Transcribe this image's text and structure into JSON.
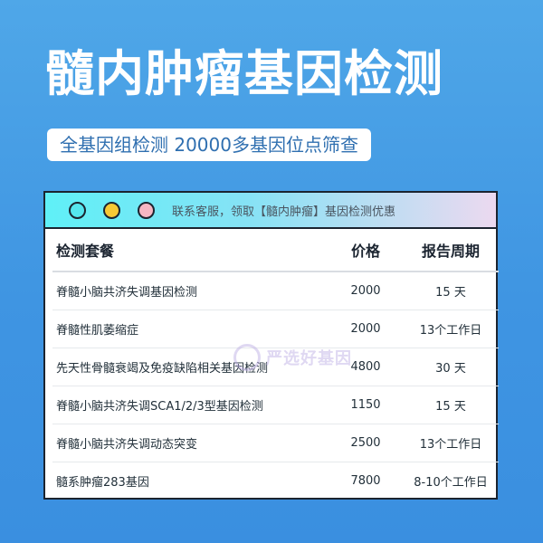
{
  "header": {
    "title": "髓内肿瘤基因检测",
    "subtitle": "全基因组检测 20000多基因位点筛查"
  },
  "window": {
    "notice": "联系客服，领取【髓内肿瘤】基因检测优惠",
    "dots": [
      "#55e6ee",
      "#f7c934",
      "#f5b6c3"
    ]
  },
  "table": {
    "headers": [
      "检测套餐",
      "价格",
      "报告周期"
    ],
    "rows": [
      {
        "name": "脊髓小脑共济失调基因检测",
        "price": "2000",
        "period": "15 天"
      },
      {
        "name": "脊髓性肌萎缩症",
        "price": "2000",
        "period": "13个工作日"
      },
      {
        "name": "先天性骨髓衰竭及免疫缺陷相关基因检测",
        "price": "4800",
        "period": "30 天"
      },
      {
        "name": "脊髓小脑共济失调SCA1/2/3型基因检测",
        "price": "1150",
        "period": "15 天"
      },
      {
        "name": "脊髓小脑共济失调动态突变",
        "price": "2500",
        "period": "13个工作日"
      },
      {
        "name": "髓系肿瘤283基因",
        "price": "7800",
        "period": "8-10个工作日"
      }
    ]
  },
  "watermark": {
    "text": "严选好基因"
  }
}
